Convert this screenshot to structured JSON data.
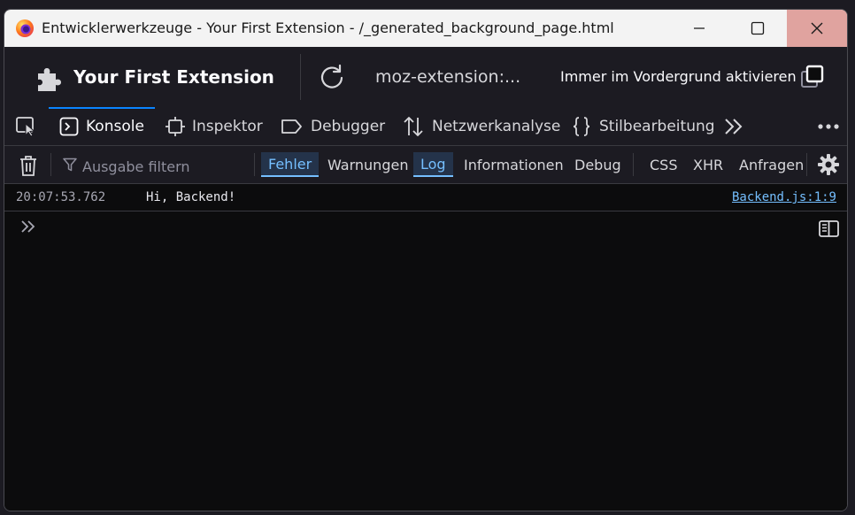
{
  "window": {
    "title": "Entwicklerwerkzeuge - Your First Extension - /_generated_background_page.html",
    "icons": [
      "firefox-logo",
      "minimize-icon",
      "maximize-icon",
      "close-icon"
    ]
  },
  "header": {
    "extension_name": "Your First Extension",
    "url": "moz-extension:...",
    "always_on_top_label": "Immer im Vordergrund aktivieren"
  },
  "tabs": [
    {
      "label": "Konsole",
      "icon": "console-icon",
      "active": true
    },
    {
      "label": "Inspektor",
      "icon": "inspector-icon"
    },
    {
      "label": "Debugger",
      "icon": "debugger-icon"
    },
    {
      "label": "Netzwerkanalyse",
      "icon": "network-icon"
    },
    {
      "label": "Stilbearbeitung",
      "icon": "style-editor-icon"
    }
  ],
  "filterbar": {
    "placeholder": "Ausgabe filtern",
    "levels": [
      {
        "label": "Fehler",
        "active": true
      },
      {
        "label": "Warnungen",
        "active": false
      },
      {
        "label": "Log",
        "active": true
      },
      {
        "label": "Informationen",
        "active": false
      },
      {
        "label": "Debug",
        "active": false
      }
    ],
    "extras": [
      "CSS",
      "XHR",
      "Anfragen"
    ]
  },
  "console": {
    "messages": [
      {
        "timestamp": "20:07:53.762",
        "text": "Hi, Backend!",
        "source": "Backend.js:1:9"
      }
    ]
  },
  "colors": {
    "accent": "#0a84ff",
    "link": "#75bfff",
    "background": "#0c0c0d",
    "toolbar": "#1c1b22",
    "close_button": "#e0a39f"
  }
}
